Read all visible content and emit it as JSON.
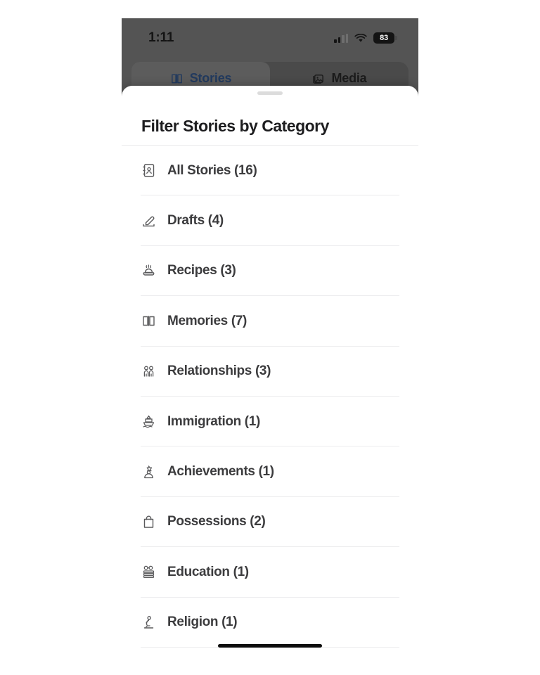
{
  "status_bar": {
    "time": "1:11",
    "battery_percent": "83",
    "signal_icon": "cellular-signal-icon",
    "wifi_icon": "wifi-icon",
    "battery_icon": "battery-icon"
  },
  "tabs": [
    {
      "label": "Stories",
      "icon": "book-icon",
      "active": true
    },
    {
      "label": "Media",
      "icon": "photos-icon",
      "active": false
    }
  ],
  "sheet": {
    "title": "Filter Stories by Category",
    "drag_handle": "sheet-drag-handle"
  },
  "categories": [
    {
      "label": "All Stories (16)",
      "name": "all-stories",
      "icon": "contact-book-icon",
      "count": 16
    },
    {
      "label": "Drafts (4)",
      "name": "drafts",
      "icon": "pencil-signature-icon",
      "count": 4
    },
    {
      "label": "Recipes (3)",
      "name": "recipes",
      "icon": "steaming-bowl-icon",
      "count": 3
    },
    {
      "label": "Memories (7)",
      "name": "memories",
      "icon": "open-book-icon",
      "count": 7
    },
    {
      "label": "Relationships (3)",
      "name": "relationships",
      "icon": "two-people-icon",
      "count": 3
    },
    {
      "label": "Immigration (1)",
      "name": "immigration",
      "icon": "boat-icon",
      "count": 1
    },
    {
      "label": "Achievements (1)",
      "name": "achievements",
      "icon": "person-medal-icon",
      "count": 1
    },
    {
      "label": "Possessions (2)",
      "name": "possessions",
      "icon": "shopping-bag-icon",
      "count": 2
    },
    {
      "label": "Education (1)",
      "name": "education",
      "icon": "glasses-books-icon",
      "count": 1
    },
    {
      "label": "Religion (1)",
      "name": "religion",
      "icon": "praying-person-icon",
      "count": 1
    }
  ],
  "colors": {
    "dim_overlay": "#545454",
    "sheet_background": "#ffffff",
    "title_text": "#1d1d1f",
    "row_text": "#3c3c3e",
    "separator": "#ececee",
    "active_tab_text": "#223a5e",
    "home_indicator": "#0d0d0d"
  },
  "home_indicator": "home-indicator-bar"
}
